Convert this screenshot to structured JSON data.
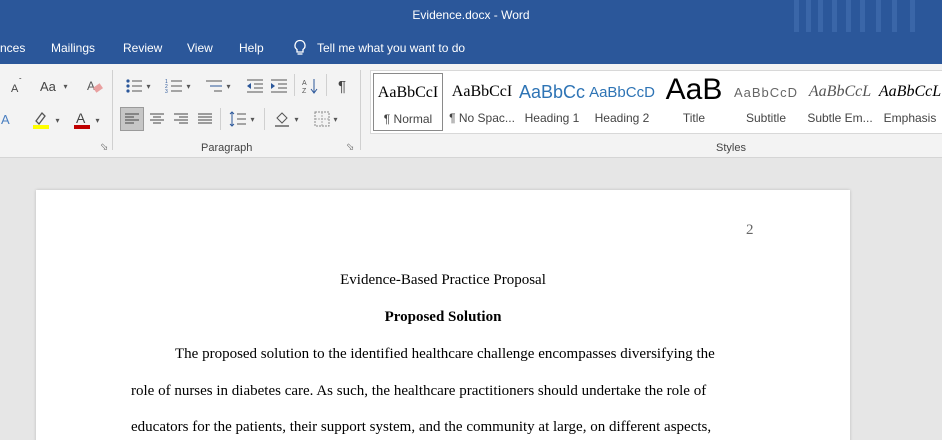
{
  "window": {
    "title": "Evidence.docx  -  Word"
  },
  "menu": {
    "items": [
      "nces",
      "Mailings",
      "Review",
      "View",
      "Help"
    ],
    "tell_me": "Tell me what you want to do"
  },
  "ribbon": {
    "paragraph_label": "Paragraph",
    "styles_label": "Styles",
    "styles": [
      {
        "sample": "AaBbCcI",
        "name": "¶ Normal"
      },
      {
        "sample": "AaBbCcI",
        "name": "¶ No Spac..."
      },
      {
        "sample": "AaBbCc",
        "name": "Heading 1"
      },
      {
        "sample": "AaBbCcD",
        "name": "Heading 2"
      },
      {
        "sample": "AaB",
        "name": "Title"
      },
      {
        "sample": "AaBbCcD",
        "name": "Subtitle"
      },
      {
        "sample": "AaBbCcL",
        "name": "Subtle Em..."
      },
      {
        "sample": "AaBbCcL",
        "name": "Emphasis"
      }
    ],
    "colors": {
      "highlight": "#ffff00",
      "font_color": "#c00000",
      "title_bar": "#2b579a"
    }
  },
  "document": {
    "page_number": "2",
    "running_title": "Evidence-Based Practice Proposal",
    "heading": "Proposed Solution",
    "lines": [
      "The proposed solution to the identified healthcare challenge encompasses diversifying the",
      "role of nurses in diabetes care. As such, the healthcare practitioners should undertake the role of",
      "educators for the patients, their support system, and the community at large, on different aspects,"
    ]
  }
}
